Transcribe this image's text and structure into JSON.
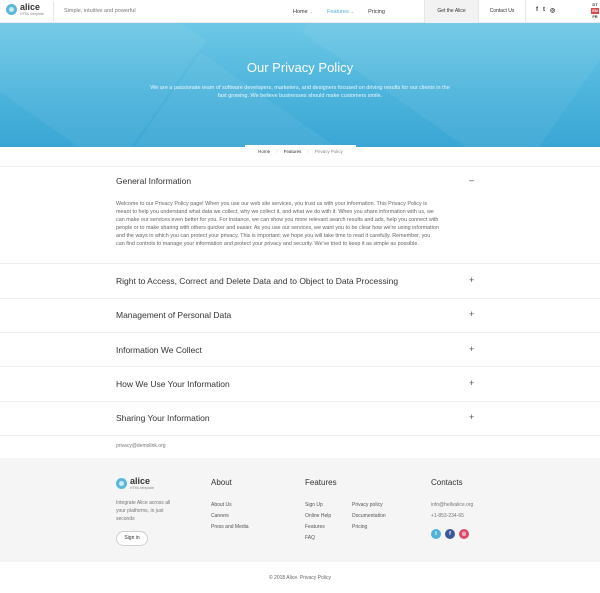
{
  "header": {
    "logo_name": "alice",
    "logo_sub": "HTML template",
    "tagline": "Simple, intuitive and powerful",
    "nav": [
      {
        "label": "Home",
        "caret": "⌄"
      },
      {
        "label": "Features",
        "caret": "⌄"
      },
      {
        "label": "Pricing",
        "caret": ""
      }
    ],
    "get_alice": "Get the Alice",
    "contact": "Contact Us",
    "socials": [
      "f",
      "t",
      "◎"
    ],
    "langs": [
      "DT",
      "EN",
      "FR"
    ]
  },
  "hero": {
    "title": "Our Privacy Policy",
    "text": "We are a passionate team of software developers, marketers, and designers focused on driving results for our clients in the fast growing. We believe businesses should make customers smile."
  },
  "breadcrumb": {
    "items": [
      "Home",
      "Features",
      "Privacy Policy"
    ],
    "sep": "›"
  },
  "sections": [
    {
      "title": "General Information",
      "toggle": "–",
      "body": "Welcome to our Privacy Policy page! When you use our web site services, you trust us with your information. This Privacy Policy is meant to help you understand what data we collect, why we collect it, and what we do with it. When you share information with us, we can make our services even better for you. For instance, we can show you more relevant search results and ads, help you connect with people or to make sharing with others quicker and easier. As you use our services, we want you to be clear how we're using information and the ways in which you can protect your privacy. This is important; we hope you will take time to read it carefully. Remember, you can find controls to manage your information and protect your privacy and security. We've tried to keep it as simple as possible."
    },
    {
      "title": "Right to Access, Correct and Delete Data and to Object to Data Processing",
      "toggle": "+"
    },
    {
      "title": "Management of Personal Data",
      "toggle": "+"
    },
    {
      "title": "Information We Collect",
      "toggle": "+"
    },
    {
      "title": "How We Use Your Information",
      "toggle": "+"
    },
    {
      "title": "Sharing Your Information",
      "toggle": "+"
    }
  ],
  "email": "privacy@demolink.org",
  "footer": {
    "description": "Integrate Alice across all your platforms, in just seconds",
    "signin": "Sign in",
    "about_title": "About",
    "about_links": [
      "About Us",
      "Careers",
      "Press and Media"
    ],
    "features_title": "Features",
    "features_links_1": [
      "Sign Up",
      "Online Help",
      "Features",
      "FAQ"
    ],
    "features_links_2": [
      "Privacy policy",
      "Documentation",
      "Pricing"
    ],
    "contacts_title": "Contacts",
    "contact_email": "info@hellvalice.org",
    "contact_phone": "+1-853-234-65",
    "social_colors": [
      "#4fb3d9",
      "#3b5998",
      "#d94b6b"
    ],
    "social_icons": [
      "t",
      "f",
      "◎"
    ]
  },
  "copyright": "© 2018 Alice. Privacy Policy"
}
